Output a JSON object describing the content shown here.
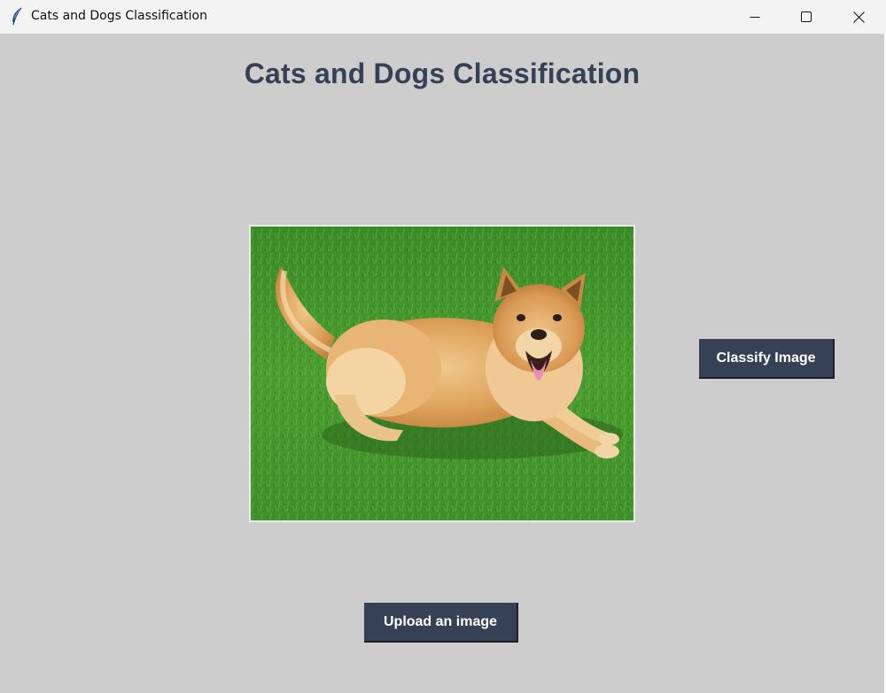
{
  "window": {
    "title": "Cats and Dogs Classification",
    "icon": "feather-icon",
    "controls": [
      "minimize-icon",
      "maximize-icon",
      "close-icon"
    ]
  },
  "main": {
    "heading": "Cats and Dogs Classification",
    "image": {
      "subject": "dog-photo"
    },
    "classify_button": "Classify Image",
    "upload_button": "Upload an image"
  },
  "colors": {
    "background": "#cdcdcd",
    "accent": "#364156",
    "button_text": "#ffffff",
    "titlebar": "#f3f3f3"
  }
}
